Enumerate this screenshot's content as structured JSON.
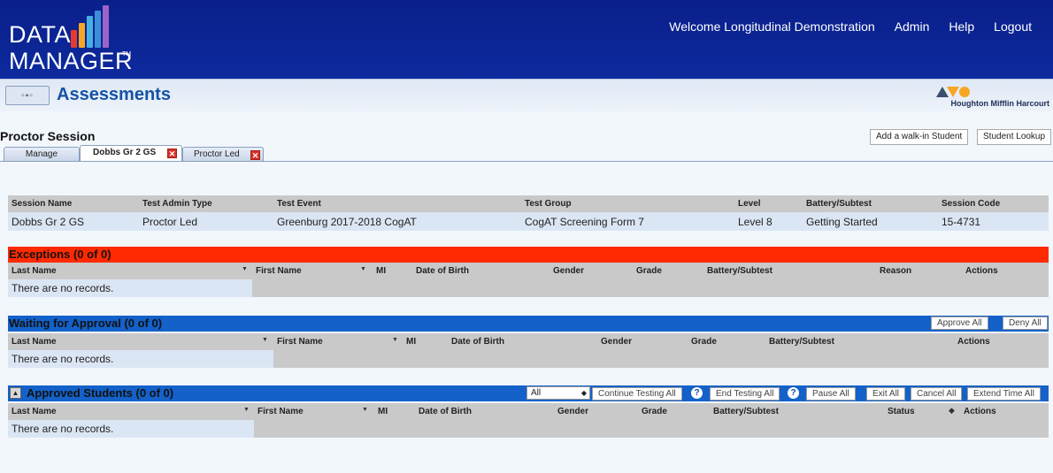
{
  "app": {
    "logo_line1": "DATA",
    "logo_line2": "MANAGER",
    "logo_tm": "TM",
    "logo_bar_colors": [
      "#e6392f",
      "#f6a623",
      "#45b0e5",
      "#3c8fd6",
      "#9c63c9"
    ]
  },
  "topnav": {
    "welcome": "Welcome Longitudinal Demonstration",
    "admin": "Admin",
    "help": "Help",
    "logout": "Logout"
  },
  "subbar": {
    "menu_icon": "grid-menu-icon",
    "title": "Assessments",
    "publisher": "Houghton Mifflin Harcourt"
  },
  "session": {
    "title": "Proctor Session",
    "add_walkin_label": "Add a walk-in Student",
    "student_lookup_label": "Student Lookup",
    "tabs": [
      {
        "label": "Manage"
      },
      {
        "label": "Dobbs Gr 2 GS"
      },
      {
        "label": "Proctor Led"
      }
    ],
    "tab_close_glyph": "✕"
  },
  "info_table": {
    "headers": [
      "Session Name",
      "Test Admin Type",
      "Test Event",
      "Test Group",
      "Level",
      "Battery/Subtest",
      "Session Code"
    ],
    "row": [
      "Dobbs Gr 2 GS",
      "Proctor Led",
      "Greenburg 2017-2018 CogAT",
      "CogAT Screening Form 7",
      "Level 8",
      "Getting Started",
      "15-4731"
    ]
  },
  "exceptions": {
    "title": "Exceptions  (0 of 0)",
    "color": "#ff2a00",
    "headers": [
      "Last Name",
      "First Name",
      "MI",
      "Date of Birth",
      "Gender",
      "Grade",
      "Battery/Subtest",
      "Reason",
      "Actions"
    ],
    "empty": "There are no records."
  },
  "waiting": {
    "title": "Waiting for Approval (0 of 0)",
    "color": "#1361c9",
    "approve_all": "Approve All",
    "deny_all": "Deny All",
    "headers": [
      "Last Name",
      "First Name",
      "MI",
      "Date of Birth",
      "Gender",
      "Grade",
      "Battery/Subtest",
      "Actions"
    ],
    "empty": "There are no records."
  },
  "approved": {
    "title": "Approved Students (0 of 0)",
    "color": "#1361c9",
    "filter_value": "All",
    "buttons": {
      "continue_testing_all": "Continue Testing All",
      "end_testing_all": "End Testing All",
      "pause_all": "Pause All",
      "exit_all": "Exit All",
      "cancel_all": "Cancel All",
      "extend_time_all": "Extend Time All"
    },
    "help_glyph": "?",
    "headers": [
      "Last Name",
      "First Name",
      "MI",
      "Date of Birth",
      "Gender",
      "Grade",
      "Battery/Subtest",
      "Status",
      "Actions"
    ],
    "empty": "There are no records."
  }
}
